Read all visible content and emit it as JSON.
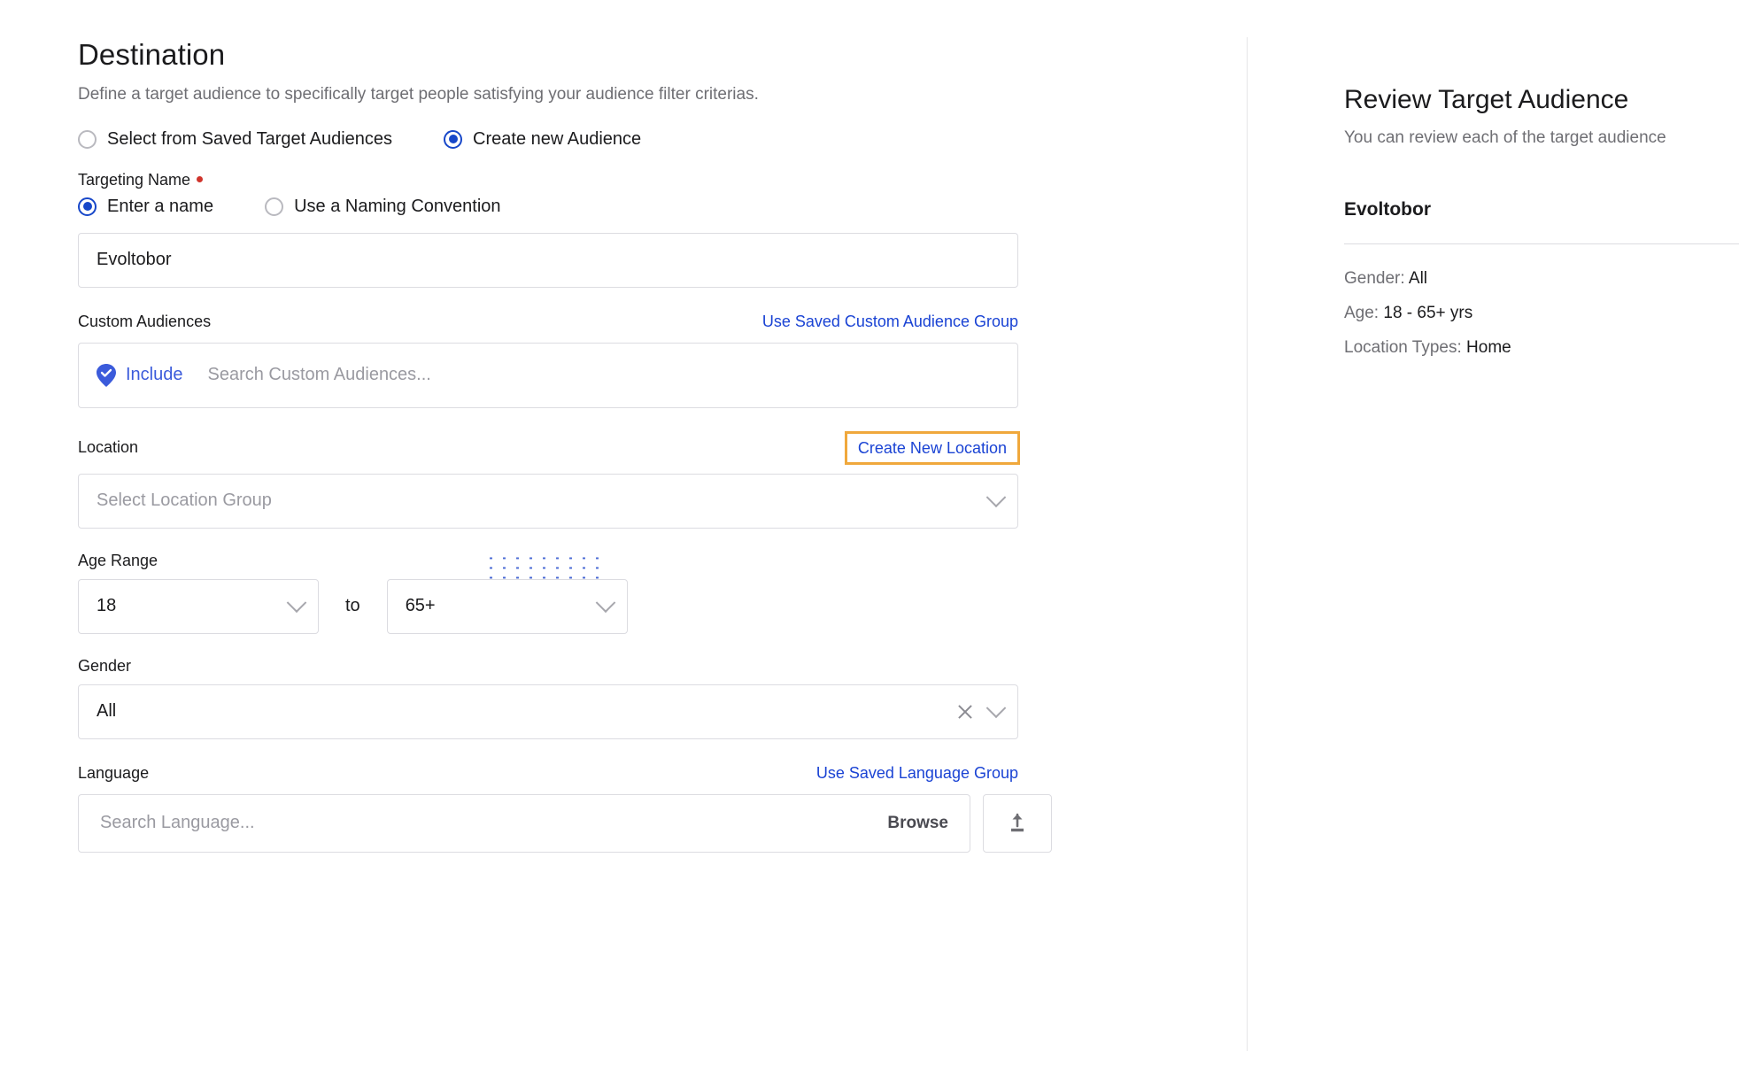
{
  "destination": {
    "title": "Destination",
    "subtitle": "Define a target audience to specifically target people satisfying your audience filter criterias.",
    "audience_source": {
      "option_saved": "Select from Saved Target Audiences",
      "option_new": "Create new Audience",
      "selected": "Create new Audience"
    },
    "targeting_name": {
      "label": "Targeting Name",
      "option_enter": "Enter a name",
      "option_convention": "Use a Naming Convention",
      "selected": "Enter a name",
      "value": "Evoltobor"
    },
    "custom_audiences": {
      "label": "Custom Audiences",
      "link": "Use Saved Custom Audience Group",
      "include_label": "Include",
      "include_icon": "shield-check-icon",
      "search_placeholder": "Search Custom Audiences..."
    },
    "location": {
      "label": "Location",
      "link": "Create New Location",
      "link_highlighted": true,
      "select_placeholder": "Select Location Group",
      "chevron_icon": "chevron-down-icon"
    },
    "age_range": {
      "label": "Age Range",
      "from": "18",
      "to_word": "to",
      "to": "65+",
      "chevron_icon": "chevron-down-icon"
    },
    "gender": {
      "label": "Gender",
      "value": "All",
      "clear_icon": "close-icon",
      "chevron_icon": "chevron-down-icon"
    },
    "language": {
      "label": "Language",
      "link": "Use Saved Language Group",
      "search_placeholder": "Search Language...",
      "browse_label": "Browse",
      "upload_icon": "upload-icon"
    }
  },
  "review": {
    "title": "Review Target Audience",
    "subtitle": "You can review each of the target audience",
    "audience_name": "Evoltobor",
    "details": [
      {
        "label": "Gender:",
        "value": "All"
      },
      {
        "label": "Age:",
        "value": "18 - 65+ yrs"
      },
      {
        "label": "Location Types:",
        "value": "Home"
      }
    ]
  },
  "colors": {
    "link": "#1a43d4",
    "highlight_border": "#f0a83c",
    "radio_selected": "#1747c9",
    "required_dot": "#d0342c",
    "include_chip": "#3b5bdb"
  }
}
